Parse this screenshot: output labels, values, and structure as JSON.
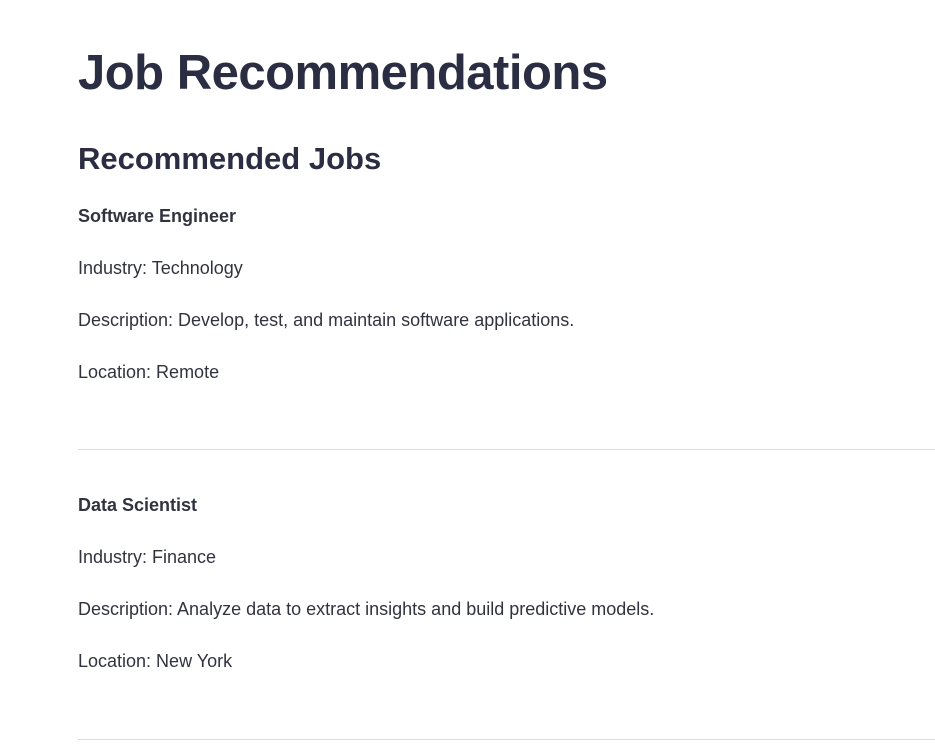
{
  "page": {
    "title": "Job Recommendations",
    "section_title": "Recommended Jobs"
  },
  "jobs": [
    {
      "title": "Software Engineer",
      "industry": "Industry: Technology",
      "description": "Description: Develop, test, and maintain software applications.",
      "location": "Location: Remote"
    },
    {
      "title": "Data Scientist",
      "industry": "Industry: Finance",
      "description": "Description: Analyze data to extract insights and build predictive models.",
      "location": "Location: New York"
    }
  ]
}
